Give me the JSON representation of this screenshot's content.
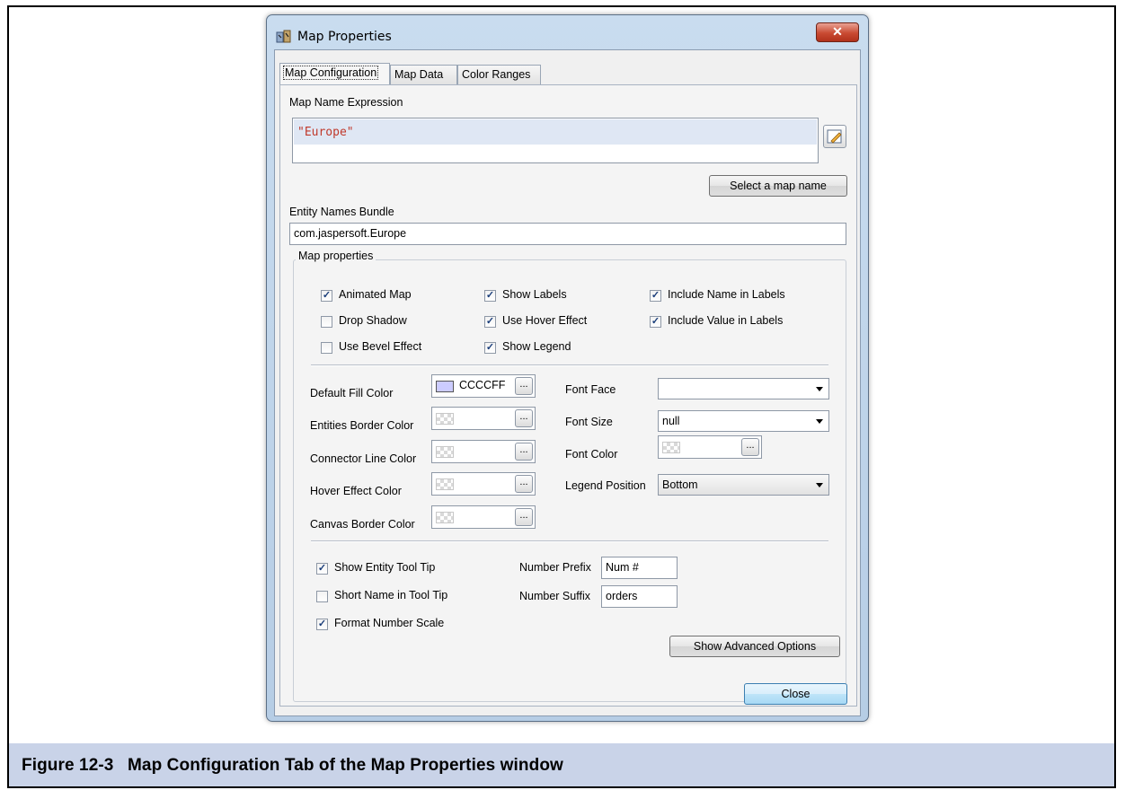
{
  "window": {
    "title": "Map Properties",
    "close_glyph": "✕"
  },
  "tabs": [
    {
      "label": "Map Configuration",
      "active": true
    },
    {
      "label": "Map Data",
      "active": false
    },
    {
      "label": "Color Ranges",
      "active": false
    }
  ],
  "map_name": {
    "label": "Map Name Expression",
    "expression": "\"Europe\"",
    "select_button": "Select a map name"
  },
  "entity_names": {
    "label": "Entity Names Bundle",
    "value": "com.jaspersoft.Europe"
  },
  "map_properties": {
    "title": "Map properties",
    "checkboxes": [
      {
        "label": "Animated Map",
        "checked": true
      },
      {
        "label": "Show Labels",
        "checked": true
      },
      {
        "label": "Include Name in Labels",
        "checked": true
      },
      {
        "label": "Drop Shadow",
        "checked": false
      },
      {
        "label": "Use Hover Effect",
        "checked": true
      },
      {
        "label": "Include Value in Labels",
        "checked": true
      },
      {
        "label": "Use Bevel Effect",
        "checked": false
      },
      {
        "label": "Show Legend",
        "checked": true
      }
    ],
    "colors": [
      {
        "label": "Default Fill Color",
        "value": "CCCCFF",
        "swatch": "#ccccff"
      },
      {
        "label": "Entities Border Color",
        "value": ""
      },
      {
        "label": "Connector Line Color",
        "value": ""
      },
      {
        "label": "Hover Effect Color",
        "value": ""
      },
      {
        "label": "Canvas Border Color",
        "value": ""
      }
    ],
    "button_ellipsis": "...",
    "font_face": {
      "label": "Font Face",
      "value": ""
    },
    "font_size": {
      "label": "Font Size",
      "value": "null"
    },
    "font_color": {
      "label": "Font Color",
      "value": ""
    },
    "legend_position": {
      "label": "Legend Position",
      "value": "Bottom"
    },
    "tooltip_checks": [
      {
        "label": "Show Entity Tool Tip",
        "checked": true
      },
      {
        "label": "Short Name in Tool Tip",
        "checked": false
      },
      {
        "label": "Format Number Scale",
        "checked": true
      }
    ],
    "number_prefix": {
      "label": "Number Prefix",
      "value": "Num #"
    },
    "number_suffix": {
      "label": "Number Suffix",
      "value": "orders"
    },
    "advanced_button": "Show Advanced Options"
  },
  "close_button": "Close",
  "caption": {
    "number": "Figure 12-3",
    "text": "Map Configuration Tab of the Map Properties window"
  },
  "colors": {
    "caption_bg": "#c9d3e8",
    "expression_text": "#c0392b",
    "fill_swatch": "#ccccff"
  }
}
